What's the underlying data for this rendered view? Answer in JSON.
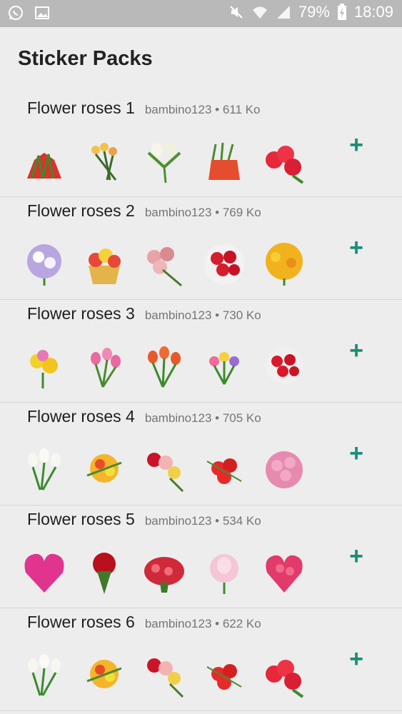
{
  "status_bar": {
    "battery": "79%",
    "time": "18:09",
    "icons": [
      "whatsapp-icon",
      "image-icon",
      "mute-icon",
      "wifi-icon",
      "signal-icon",
      "battery-icon"
    ]
  },
  "page": {
    "title": "Sticker Packs"
  },
  "packs": [
    {
      "name": "Flower roses 1",
      "author": "bambino123",
      "separator": "•",
      "size": "611 Ko",
      "add_label": "+"
    },
    {
      "name": "Flower roses 2",
      "author": "bambino123",
      "separator": "•",
      "size": "769 Ko",
      "add_label": "+"
    },
    {
      "name": "Flower roses 3",
      "author": "bambino123",
      "separator": "•",
      "size": "730 Ko",
      "add_label": "+"
    },
    {
      "name": "Flower roses 4",
      "author": "bambino123",
      "separator": "•",
      "size": "705 Ko",
      "add_label": "+"
    },
    {
      "name": "Flower roses 5",
      "author": "bambino123",
      "separator": "•",
      "size": "534 Ko",
      "add_label": "+"
    },
    {
      "name": "Flower roses 6",
      "author": "bambino123",
      "separator": "•",
      "size": "622 Ko",
      "add_label": "+"
    }
  ],
  "colors": {
    "accent": "#1a8f76",
    "status_bar": "#b9b9b9",
    "background": "#ededed"
  }
}
